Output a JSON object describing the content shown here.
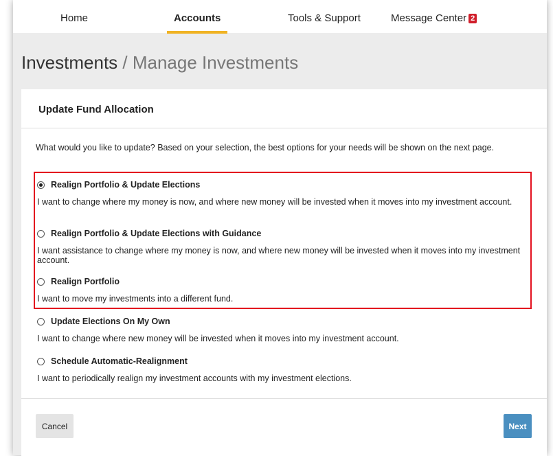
{
  "nav": {
    "items": [
      {
        "label": "Home",
        "active": false
      },
      {
        "label": "Accounts",
        "active": true
      },
      {
        "label": "Tools & Support",
        "active": false
      },
      {
        "label": "Message Center",
        "active": false,
        "badge": "2"
      }
    ],
    "accent_color": "#f0b323",
    "badge_color": "#d11f2b"
  },
  "page": {
    "title": "Investments",
    "separator": " / ",
    "subtitle": "Manage Investments"
  },
  "card": {
    "header": "Update Fund Allocation",
    "intro": "What would you like to update? Based on your selection, the best options for your needs will be shown on the next page.",
    "options": [
      {
        "label": "Realign Portfolio & Update Elections",
        "description": "I want to change where my money is now, and where new money will be invested when it moves into my investment account.",
        "selected": true
      },
      {
        "label": "Realign Portfolio & Update Elections with Guidance",
        "description": "I want assistance to change where my money is now, and where new money will be invested when it moves into my investment account.",
        "selected": false
      },
      {
        "label": "Realign Portfolio",
        "description": "I want to move my investments into a different fund.",
        "selected": false
      },
      {
        "label": "Update Elections On My Own",
        "description": "I want to change where new money will be invested when it moves into my investment account.",
        "selected": false
      },
      {
        "label": "Schedule Automatic-Realignment",
        "description": "I want to periodically realign my investment accounts with my investment elections.",
        "selected": false
      }
    ],
    "highlight_color": "#e3101e"
  },
  "footer": {
    "cancel_label": "Cancel",
    "next_label": "Next",
    "next_color": "#4a8fc0"
  }
}
